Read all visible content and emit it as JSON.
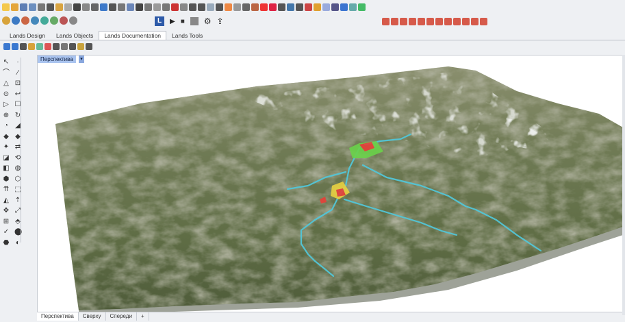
{
  "toolbar": {
    "row1_colors": [
      "#f4c84c",
      "#e4a53a",
      "#5f7fb4",
      "#6c8fbf",
      "#777",
      "#555",
      "#d9a441",
      "#aaa",
      "#444",
      "#888",
      "#666",
      "#3d79c9",
      "#555",
      "#777",
      "#6b86b8",
      "#444",
      "#777",
      "#9a9a9a",
      "#777",
      "#c33",
      "#888",
      "#555",
      "#555",
      "#9ab",
      "#555",
      "#e84",
      "#999",
      "#666",
      "#b64",
      "#e33",
      "#d24",
      "#555",
      "#47a",
      "#555",
      "#c44",
      "#e0a030",
      "#9ad",
      "#558",
      "#3b74d0",
      "#6aa",
      "#4b6"
    ],
    "row2_colors": [
      "#d8a33a",
      "#3d7ac4",
      "#c64",
      "#48b",
      "#4a9",
      "#6a6",
      "#b55",
      "#888"
    ],
    "row2_right_colors": [
      "#d65a4a",
      "#d65a4a",
      "#d65a4a",
      "#d65a4a",
      "#d65a4a",
      "#d65a4a",
      "#d65a4a",
      "#d65a4a",
      "#d65a4a",
      "#d65a4a",
      "#d65a4a",
      "#d65a4a"
    ],
    "row3_colors": [
      "#3a78d0",
      "#3a78d0",
      "#555",
      "#d8a23a",
      "#6b9",
      "#d55",
      "#555",
      "#777",
      "#555",
      "#c9a33d",
      "#555"
    ],
    "playback": {
      "l_icon": "L",
      "play": "▶",
      "stop": "■",
      "gear": "⚙",
      "upload": "⇪"
    }
  },
  "tabs": [
    {
      "label": "Lands Design",
      "active": false
    },
    {
      "label": "Lands Objects",
      "active": false
    },
    {
      "label": "Lands Documentation",
      "active": true
    },
    {
      "label": "Lands Tools",
      "active": false
    }
  ],
  "viewport": {
    "title": "Перспектива",
    "dropdown": "▾"
  },
  "view_tabs": [
    {
      "label": "Перспектива",
      "active": true
    },
    {
      "label": "Сверху",
      "active": false
    },
    {
      "label": "Спереди",
      "active": false
    },
    {
      "label": "+",
      "active": false
    }
  ],
  "left_tools": [
    "↖",
    "·",
    "⌒",
    "∕",
    "△",
    "⊡",
    "⊙",
    "↩",
    "▷",
    "☐",
    "⊕",
    "↻",
    "◔",
    "◢",
    "◆",
    "◆",
    "✦",
    "⇄",
    "◪",
    "⟲",
    "◧",
    "◍",
    "⬢",
    "⬡",
    "⇈",
    "⬚",
    "◭",
    "⇡",
    "✥",
    "⤢",
    "⊞",
    "⬘",
    "✓",
    "⬤",
    "⬣",
    "◐"
  ]
}
